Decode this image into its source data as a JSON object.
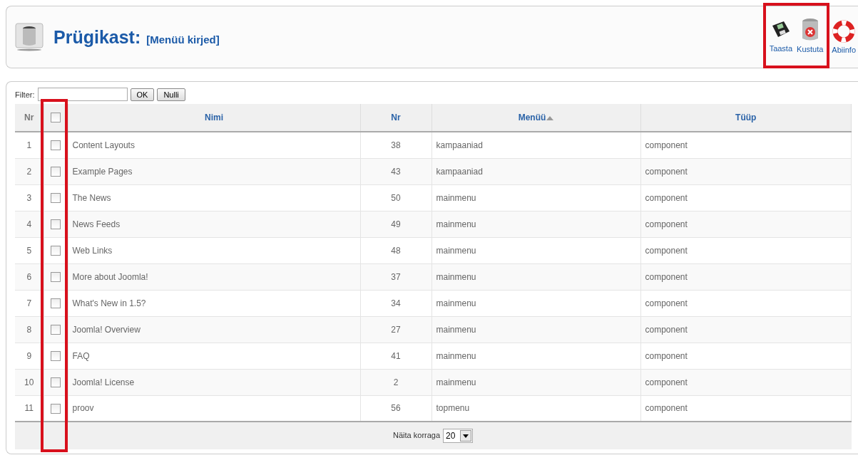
{
  "header": {
    "title": "Prügikast:",
    "subtitle": "[Menüü kirjed]"
  },
  "toolbar": [
    {
      "kind": "restore",
      "label": "Taasta",
      "highlighted": true
    },
    {
      "kind": "delete",
      "label": "Kustuta",
      "highlighted": true
    },
    {
      "kind": "help",
      "label": "Abiinfo",
      "highlighted": false
    }
  ],
  "filter": {
    "label": "Filter:",
    "buttons": [
      "OK",
      "Nulli"
    ]
  },
  "table": {
    "columns": [
      {
        "label": "Nr",
        "kind": "num"
      },
      {
        "kind": "check",
        "checked": false
      },
      {
        "label": "Nimi",
        "kind": "text"
      },
      {
        "label": "Nr",
        "kind": "id"
      },
      {
        "label": "Menüü",
        "kind": "text",
        "sorted": true
      },
      {
        "label": "Tüüp",
        "kind": "text"
      }
    ],
    "rows": [
      {
        "num": "1",
        "checked": false,
        "name": "Content Layouts",
        "id": "38",
        "menu": "kampaaniad",
        "type": "component"
      },
      {
        "num": "2",
        "checked": false,
        "name": "Example Pages",
        "id": "43",
        "menu": "kampaaniad",
        "type": "component"
      },
      {
        "num": "3",
        "checked": false,
        "name": "The News",
        "id": "50",
        "menu": "mainmenu",
        "type": "component"
      },
      {
        "num": "4",
        "checked": false,
        "name": "News Feeds",
        "id": "49",
        "menu": "mainmenu",
        "type": "component"
      },
      {
        "num": "5",
        "checked": false,
        "name": "Web Links",
        "id": "48",
        "menu": "mainmenu",
        "type": "component"
      },
      {
        "num": "6",
        "checked": false,
        "name": "More about Joomla!",
        "id": "37",
        "menu": "mainmenu",
        "type": "component"
      },
      {
        "num": "7",
        "checked": false,
        "name": "What's New in 1.5?",
        "id": "34",
        "menu": "mainmenu",
        "type": "component"
      },
      {
        "num": "8",
        "checked": false,
        "name": "Joomla! Overview",
        "id": "27",
        "menu": "mainmenu",
        "type": "component"
      },
      {
        "num": "9",
        "checked": false,
        "name": "FAQ",
        "id": "41",
        "menu": "mainmenu",
        "type": "component"
      },
      {
        "num": "10",
        "checked": false,
        "name": "Joomla! License",
        "id": "2",
        "menu": "mainmenu",
        "type": "component"
      },
      {
        "num": "11",
        "checked": false,
        "name": "proov",
        "id": "56",
        "menu": "topmenu",
        "type": "component"
      }
    ],
    "checkbox_column_highlighted": true
  },
  "pagination": {
    "label": "Näita korraga",
    "value": "20"
  }
}
